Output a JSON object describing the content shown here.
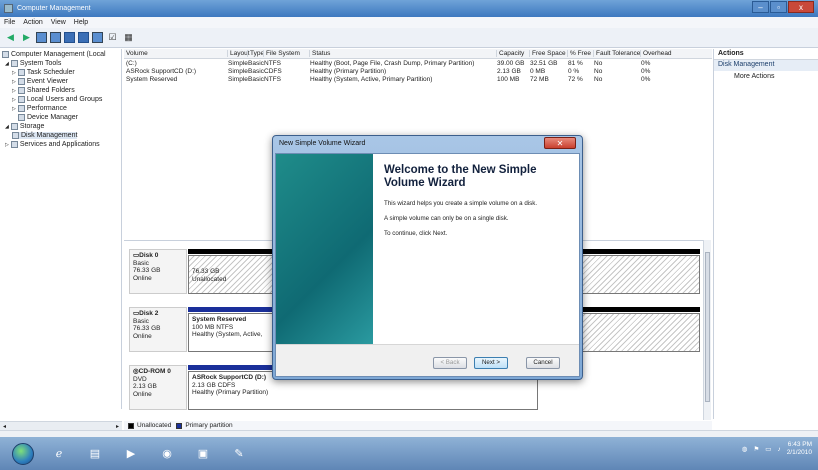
{
  "window": {
    "title": "Computer Management",
    "buttons": [
      "–",
      "▫",
      "x"
    ]
  },
  "menu": [
    "File",
    "Action",
    "View",
    "Help"
  ],
  "tree": [
    {
      "label": "Computer Management (Local",
      "level": 0
    },
    {
      "label": "System Tools",
      "level": 1
    },
    {
      "label": "Task Scheduler",
      "level": 2
    },
    {
      "label": "Event Viewer",
      "level": 2
    },
    {
      "label": "Shared Folders",
      "level": 2
    },
    {
      "label": "Local Users and Groups",
      "level": 2
    },
    {
      "label": "Performance",
      "level": 2
    },
    {
      "label": "Device Manager",
      "level": 2
    },
    {
      "label": "Storage",
      "level": 1
    },
    {
      "label": "Disk Management",
      "level": 2
    },
    {
      "label": "Services and Applications",
      "level": 1
    }
  ],
  "volume_table": {
    "headers": [
      "Volume",
      "Layout",
      "Type",
      "File System",
      "Status",
      "Capacity",
      "Free Space",
      "% Free",
      "Fault Tolerance",
      "Overhead"
    ],
    "rows": [
      [
        "(C:)",
        "Simple",
        "Basic",
        "NTFS",
        "Healthy (Boot, Page File, Crash Dump, Primary Partition)",
        "39.00 GB",
        "32.51 GB",
        "81 %",
        "No",
        "0%"
      ],
      [
        "ASRock SupportCD (D:)",
        "Simple",
        "Basic",
        "CDFS",
        "Healthy (Primary Partition)",
        "2.13 GB",
        "0 MB",
        "0 %",
        "No",
        "0%"
      ],
      [
        "System Reserved",
        "Simple",
        "Basic",
        "NTFS",
        "Healthy (System, Active, Primary Partition)",
        "100 MB",
        "72 MB",
        "72 %",
        "No",
        "0%"
      ]
    ]
  },
  "disks": [
    {
      "name": "Disk 0",
      "l1": "Basic",
      "l2": "76.33 GB",
      "l3": "Online",
      "part_title": "",
      "part_l1": "76.33 GB",
      "part_l2": "Unallocated"
    },
    {
      "name": "Disk 2",
      "l1": "Basic",
      "l2": "76.33 GB",
      "l3": "Online",
      "part_title": "System Reserved",
      "part_l1": "100 MB NTFS",
      "part_l2": "Healthy (System, Active,"
    },
    {
      "name": "CD-ROM 0",
      "l1": "DVD",
      "l2": "2.13 GB",
      "l3": "Online",
      "part_title": "ASRock SupportCD (D:)",
      "part_l1": "2.13 GB CDFS",
      "part_l2": "Healthy (Primary Partition)"
    }
  ],
  "legend": {
    "unallocated": "Unallocated",
    "primary": "Primary partition"
  },
  "actions": {
    "header": "Actions",
    "section": "Disk Management",
    "more": "More Actions"
  },
  "dialog": {
    "title": "New Simple Volume Wizard",
    "heading": "Welcome to the New Simple Volume Wizard",
    "p1": "This wizard helps you create a simple volume on a disk.",
    "p2": "A simple volume can only be on a single disk.",
    "p3": "To continue, click Next.",
    "back": "< Back",
    "next": "Next >",
    "cancel": "Cancel"
  },
  "clock": {
    "time": "6:43 PM",
    "date": "2/1/2010"
  },
  "colors": {
    "unallocated": "#000000",
    "primary": "#1a2f9a",
    "title_bar": "#4a86c8"
  }
}
